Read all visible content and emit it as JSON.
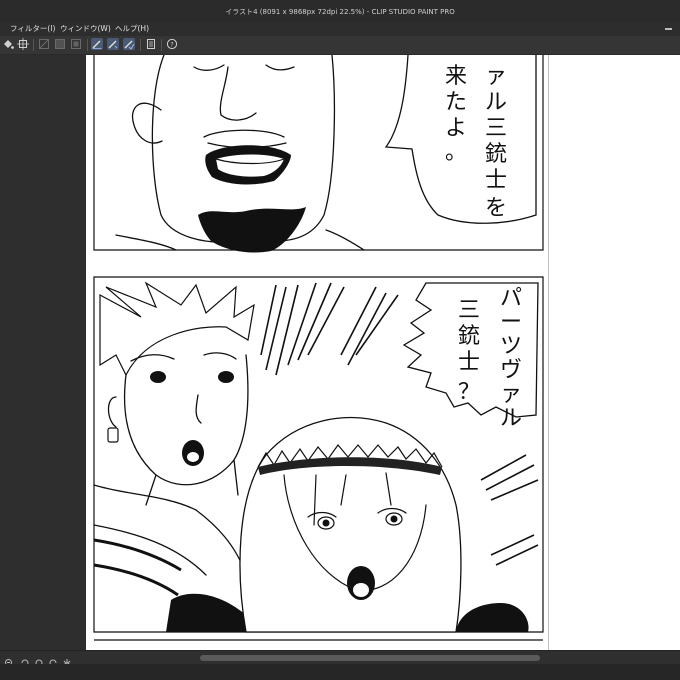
{
  "app": {
    "title": "イラスト4 (8091 x 9868px 72dpi 22.5%) - CLIP STUDIO PAINT PRO"
  },
  "menu": {
    "items": [
      "フィルター(I)",
      "ウィンドウ(W)",
      "ヘルプ(H)"
    ]
  },
  "toolbar": {
    "icons": [
      "fill-icon",
      "transform-icon",
      "clear-icon",
      "fill-gray-icon",
      "fill-selection-icon",
      "pen-active-icon",
      "pen-tool-icon",
      "pen-check-icon",
      "layer-panel-icon",
      "help-icon"
    ]
  },
  "document": {
    "zoom": "22.5%",
    "resolution": "72dpi",
    "size": "8091 x 9868px"
  },
  "manga": {
    "panel1_speech": [
      "ァル三銃士を",
      "来たよ。"
    ],
    "panel2_speech_right": "パーツヴァル",
    "panel2_speech_left": "三銃士？"
  },
  "colors": {
    "workspace": "#3a3a3a",
    "page": "#ffffff",
    "toolbar_active": "#4a5a74",
    "ink": "#111111"
  }
}
